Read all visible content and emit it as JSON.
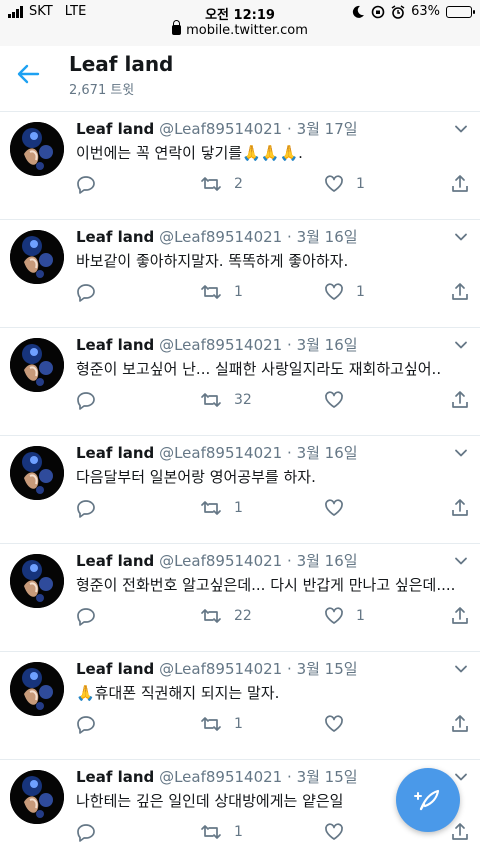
{
  "status_bar": {
    "carrier": "SKT",
    "network": "LTE",
    "time": "오전 12:19",
    "url": "mobile.twitter.com",
    "battery_text": "63%",
    "battery_level": 0.63
  },
  "header": {
    "title": "Leaf land",
    "subtitle": "2,671 트윗"
  },
  "colors": {
    "accent": "#1da1f2",
    "fab": "#4a99e9",
    "muted": "#657786",
    "divider": "#e6ecf0"
  },
  "tweets": [
    {
      "name": "Leaf land",
      "handle": "@Leaf89514021",
      "dot": "·",
      "date": "3월 17일",
      "text": "이번에는 꼭 연락이 닿기를🙏🙏🙏.",
      "retweets": "2",
      "likes": "1"
    },
    {
      "name": "Leaf land",
      "handle": "@Leaf89514021",
      "dot": "·",
      "date": "3월 16일",
      "text": "바보같이 좋아하지말자. 똑똑하게 좋아하자.",
      "retweets": "1",
      "likes": "1"
    },
    {
      "name": "Leaf land",
      "handle": "@Leaf89514021",
      "dot": "·",
      "date": "3월 16일",
      "text": "형준이 보고싶어 난...  실패한 사랑일지라도 재회하고싶어..",
      "retweets": "32",
      "likes": ""
    },
    {
      "name": "Leaf land",
      "handle": "@Leaf89514021",
      "dot": "·",
      "date": "3월 16일",
      "text": "다음달부터 일본어랑 영어공부를 하자.",
      "retweets": "1",
      "likes": ""
    },
    {
      "name": "Leaf land",
      "handle": "@Leaf89514021",
      "dot": "·",
      "date": "3월 16일",
      "text": "형준이 전화번호 알고싶은데... 다시 반갑게 만나고 싶은데....",
      "retweets": "22",
      "likes": "1"
    },
    {
      "name": "Leaf land",
      "handle": "@Leaf89514021",
      "dot": "·",
      "date": "3월 15일",
      "text": "🙏휴대폰 직권해지 되지는 말자.",
      "retweets": "1",
      "likes": ""
    },
    {
      "name": "Leaf land",
      "handle": "@Leaf89514021",
      "dot": "·",
      "date": "3월 15일",
      "text": "나한테는 깊은 일인데 상대방에게는 얕은일",
      "retweets": "1",
      "likes": ""
    }
  ]
}
